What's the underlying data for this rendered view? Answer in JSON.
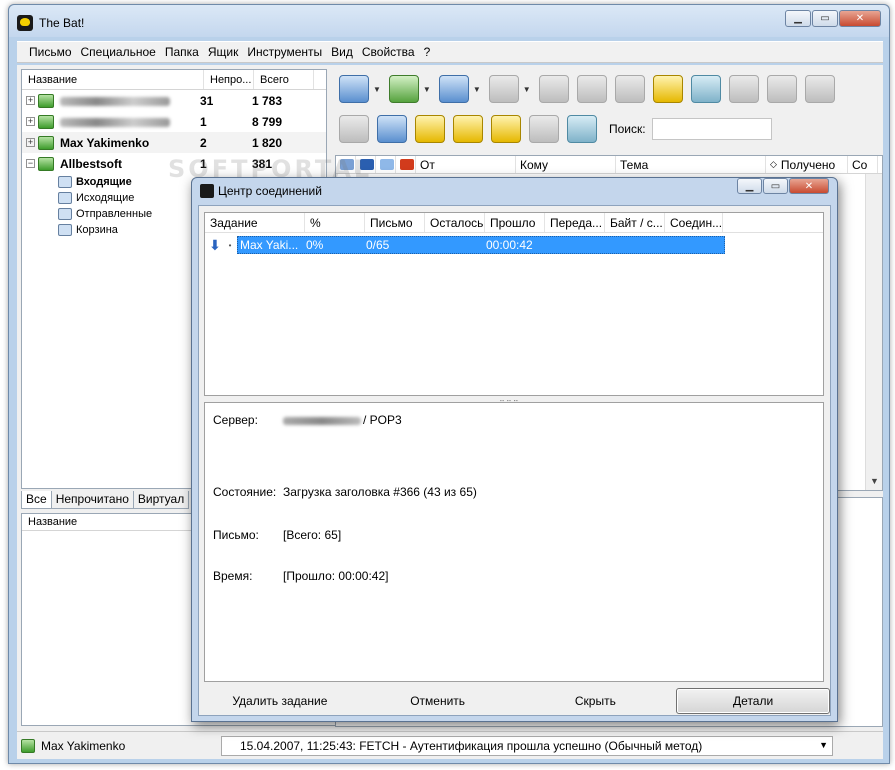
{
  "window": {
    "title": "The Bat!",
    "minimize_icon": "minimize-icon",
    "maximize_icon": "maximize-icon",
    "close_icon": "close-icon"
  },
  "menu": [
    "Письмо",
    "Специальное",
    "Папка",
    "Ящик",
    "Инструменты",
    "Вид",
    "Свойства",
    "?"
  ],
  "folder_tree": {
    "columns": [
      "Название",
      "Непро...",
      "Всего"
    ],
    "accounts": [
      {
        "name": "",
        "unread": "31",
        "total": "1 783"
      },
      {
        "name": "",
        "unread": "1",
        "total": "8 799"
      },
      {
        "name": "Max Yakimenko",
        "unread": "2",
        "total": "1 820"
      },
      {
        "name": "Allbestsoft",
        "unread": "1",
        "total": "381"
      }
    ],
    "subfolders": [
      "Входящие",
      "Исходящие",
      "Отправленные",
      "Корзина"
    ]
  },
  "tree_tabs": [
    "Все",
    "Непрочитано",
    "Виртуал"
  ],
  "address_book": {
    "header": "Название"
  },
  "search": {
    "label": "Поиск:",
    "value": ""
  },
  "message_list": {
    "columns": [
      "От",
      "Кому",
      "Тема",
      "Получено",
      "Со"
    ]
  },
  "watermark": "SOFTPORTAL",
  "connection_center": {
    "title": "Центр соединений",
    "columns": [
      "Задание",
      "%",
      "Письмо",
      "Осталось",
      "Прошло",
      "Переда...",
      "Байт / с...",
      "Соедин..."
    ],
    "task": {
      "name": "Max Yaki...",
      "percent": "0%",
      "message": "0/65",
      "remaining": "",
      "elapsed": "00:00:42"
    },
    "details": {
      "server_label": "Сервер:",
      "server_value": "/ POP3",
      "state_label": "Состояние:",
      "state_value": "Загрузка заголовка #366 (43 из 65)",
      "letter_label": "Письмо:",
      "letter_value": "[Всего: 65]",
      "time_label": "Время:",
      "time_value": "[Прошло: 00:00:42]"
    },
    "buttons": {
      "delete": "Удалить задание",
      "cancel": "Отменить",
      "hide": "Скрыть",
      "details": "Детали"
    }
  },
  "status_bar": {
    "user": "Max Yakimenko",
    "log": "15.04.2007, 11:25:43: FETCH - Аутентификация прошла успешно (Обычный метод)"
  }
}
